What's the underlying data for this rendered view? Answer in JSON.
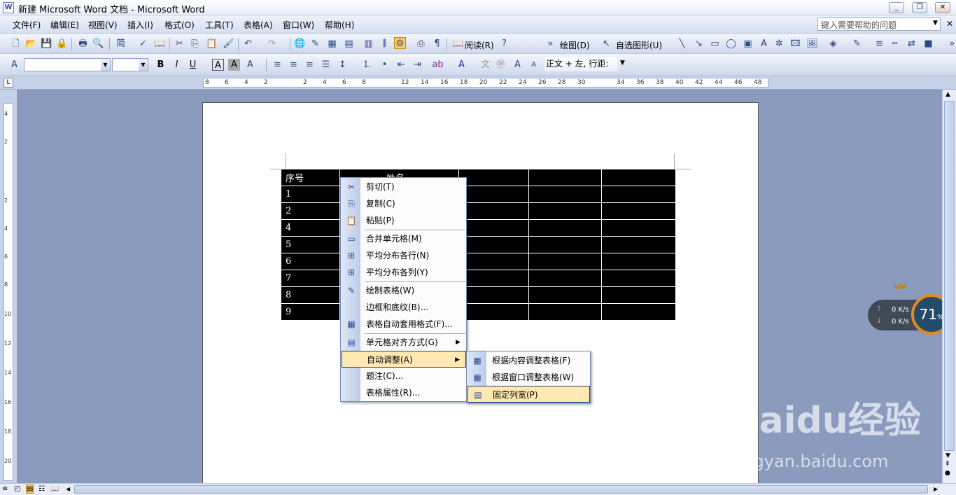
{
  "window": {
    "title": "新建 Microsoft Word 文档 - Microsoft Word"
  },
  "menu": [
    "文件(F)",
    "编辑(E)",
    "视图(V)",
    "插入(I)",
    "格式(O)",
    "工具(T)",
    "表格(A)",
    "窗口(W)",
    "帮助(H)"
  ],
  "help_placeholder": "键入需要帮助的问题",
  "toolbar": {
    "read_label": "阅读(R)",
    "draw_label": "绘图(D)",
    "autoshape_label": "自选图形(U)",
    "style_value": "正文 + 左, 行距:"
  },
  "ruler": {
    "numbers": [
      "8",
      "6",
      "4",
      "2",
      "2",
      "4",
      "6",
      "8",
      "12",
      "14",
      "16",
      "18",
      "20",
      "22",
      "24",
      "26",
      "28",
      "30",
      "34",
      "36",
      "38",
      "40",
      "42",
      "44",
      "46",
      "48"
    ]
  },
  "vruler": {
    "numbers": [
      "4",
      "2",
      "2",
      "4",
      "6",
      "8",
      "10",
      "12",
      "14",
      "16",
      "18",
      "20"
    ]
  },
  "table": {
    "header": [
      "序号",
      "姓名"
    ],
    "rows": [
      "1",
      "2",
      "4",
      "5",
      "6",
      "7",
      "8",
      "9"
    ]
  },
  "context_menu": {
    "items": [
      {
        "label": "剪切(T)",
        "icon": "scissors-icon"
      },
      {
        "label": "复制(C)",
        "icon": "copy-icon"
      },
      {
        "label": "粘贴(P)",
        "icon": "paste-icon"
      },
      {
        "label": "合并单元格(M)",
        "icon": "merge-cells-icon"
      },
      {
        "label": "平均分布各行(N)",
        "icon": "distribute-rows-icon"
      },
      {
        "label": "平均分布各列(Y)",
        "icon": "distribute-columns-icon"
      },
      {
        "label": "绘制表格(W)",
        "icon": "draw-table-icon"
      },
      {
        "label": "边框和底纹(B)...",
        "icon": ""
      },
      {
        "label": "表格自动套用格式(F)...",
        "icon": "autoformat-icon"
      },
      {
        "label": "单元格对齐方式(G)",
        "icon": "align-icon"
      },
      {
        "label": "自动调整(A)",
        "icon": ""
      },
      {
        "label": "题注(C)...",
        "icon": ""
      },
      {
        "label": "表格属性(R)...",
        "icon": ""
      }
    ]
  },
  "submenu": {
    "items": [
      {
        "label": "根据内容调整表格(F)"
      },
      {
        "label": "根据窗口调整表格(W)"
      },
      {
        "label": "固定列宽(P)"
      }
    ]
  },
  "net_widget": {
    "up": "0 K/s",
    "down": "0 K/s",
    "percent": "71",
    "percent_sign": "%",
    "badge": "VIP"
  },
  "watermark": {
    "brand": "Baidu经验",
    "url": "jingyan.baidu.com"
  }
}
